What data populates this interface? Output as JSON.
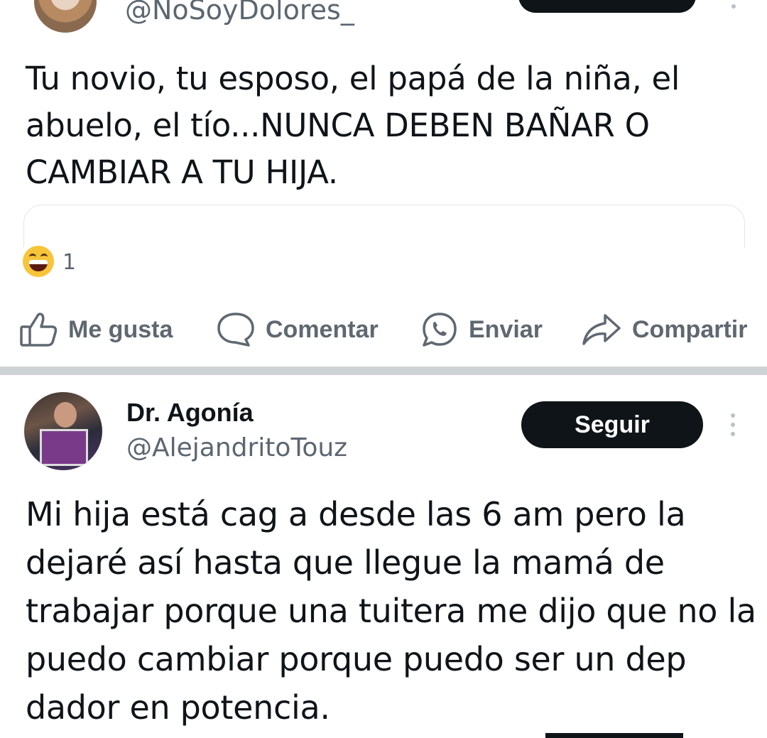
{
  "post1": {
    "handle": "@NoSoyDolores_",
    "text": "Tu novio, tu esposo, el papá de la niña, el abuelo, el tío...NUNCA DEBEN BAÑAR O CAMBIAR A TU HIJA.",
    "reaction": {
      "emoji": "laughing-face",
      "count": "1"
    },
    "actions": {
      "like": "Me gusta",
      "comment": "Comentar",
      "send": "Enviar",
      "share": "Compartir"
    }
  },
  "post2": {
    "name": "Dr. Agonía",
    "handle": "@AlejandritoTouz",
    "follow_label": "Seguir",
    "text": "Mi hija está cag   a desde las 6 am pero la dejaré así hasta que llegue la mamá de trabajar porque una tuitera me dijo que no la puedo cambiar porque puedo ser un dep   dador en potencia."
  },
  "colors": {
    "text": "#0f1419",
    "secondary": "#5b6670",
    "button": "#0f1419",
    "divider": "#cfd3d6"
  }
}
